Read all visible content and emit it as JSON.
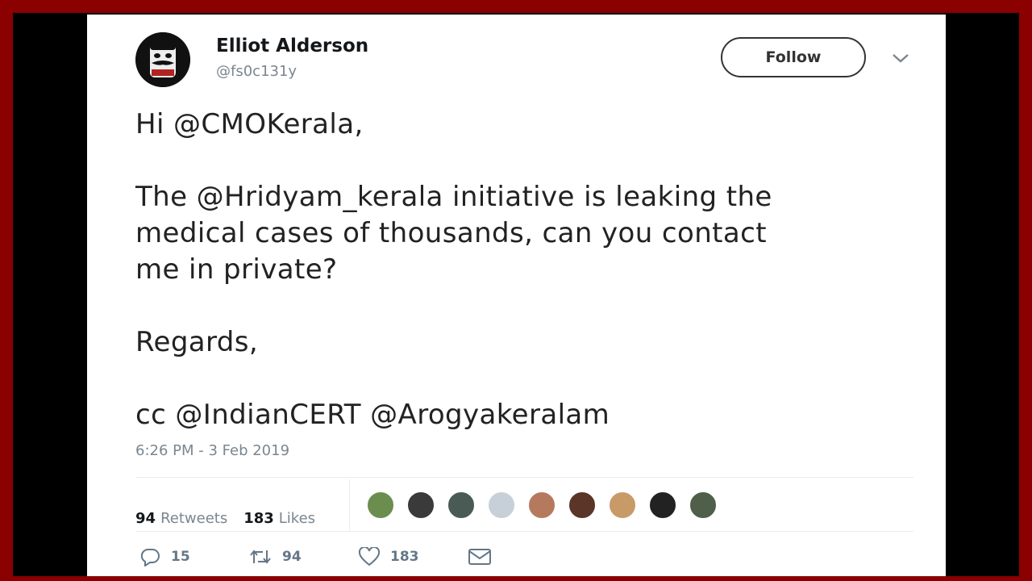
{
  "user": {
    "name": "Elliot Alderson",
    "handle": "@fs0c131y"
  },
  "follow_label": "Follow",
  "tweet": {
    "line1": "Hi @CMOKerala,",
    "line2": "The @Hridyam_kerala initiative is leaking the",
    "line3": "medical cases of thousands, can you contact",
    "line4": "me in private?",
    "line5": "Regards,",
    "line6": "cc @IndianCERT @Arogyakeralam"
  },
  "timestamp": "6:26 PM - 3 Feb 2019",
  "stats": {
    "retweets_count": "94",
    "retweets_label": "Retweets",
    "likes_count": "183",
    "likes_label": "Likes"
  },
  "likers": [
    {
      "color": "#6b8e4e"
    },
    {
      "color": "#3a3a3a"
    },
    {
      "color": "#4a5a55"
    },
    {
      "color": "#c7d0d8"
    },
    {
      "color": "#b57a5e"
    },
    {
      "color": "#5a3528"
    },
    {
      "color": "#c89a68"
    },
    {
      "color": "#222222"
    },
    {
      "color": "#4f5f4a"
    }
  ],
  "actions": {
    "replies": "15",
    "retweets": "94",
    "likes": "183"
  },
  "colors": {
    "border": "#8b0000",
    "action_grey": "#657786"
  }
}
